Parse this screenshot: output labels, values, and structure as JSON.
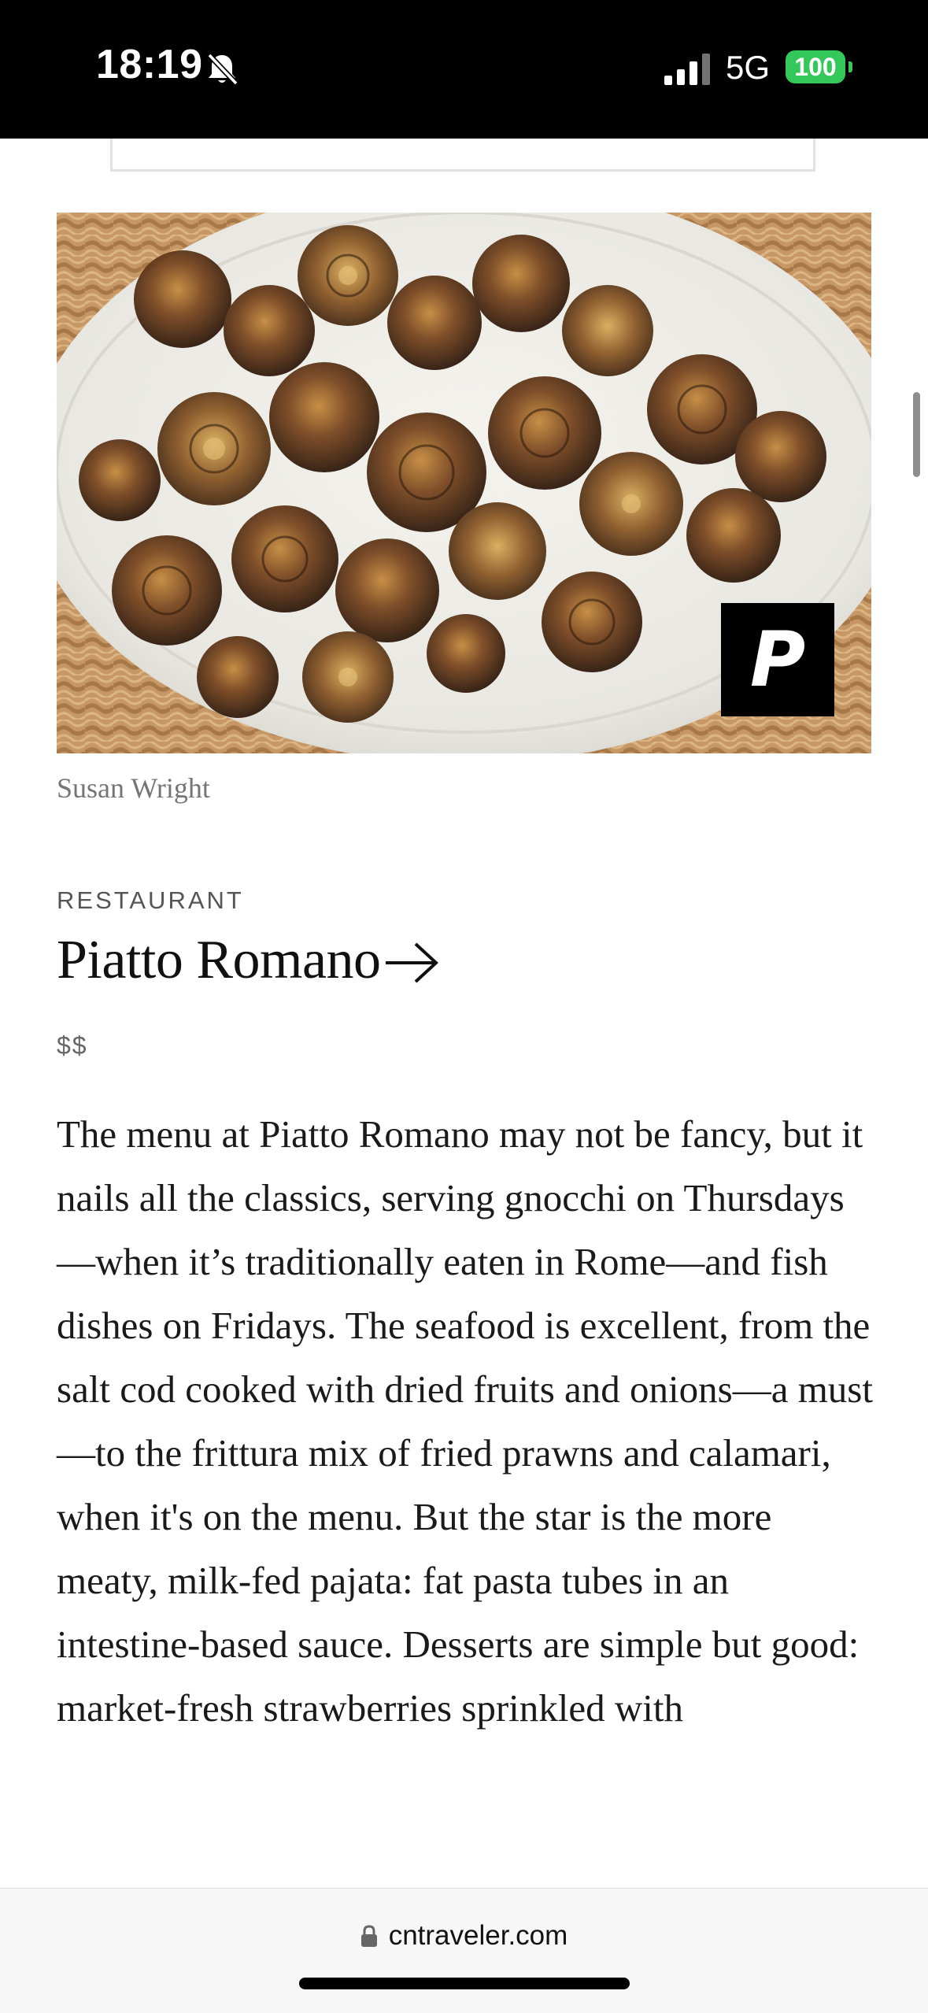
{
  "status_bar": {
    "time": "18:19",
    "network": "5G",
    "battery": "100",
    "icons": [
      "bell-slash-icon",
      "signal-icon",
      "battery-icon"
    ]
  },
  "photo": {
    "alt": "Fried artichokes on a white oval platter",
    "credit": "Susan Wright",
    "pin_icon": "pinterest-icon",
    "pin_letter": "P"
  },
  "listing": {
    "category": "RESTAURANT",
    "title": "Piatto Romano",
    "title_icon": "arrow-right-icon",
    "price": "$$",
    "description": "The menu at Piatto Romano may not be fancy, but it nails all the classics, serving gnocchi on Thursdays—when it’s traditionally eaten in Rome—and fish dishes on Fridays. The seafood is excellent, from the salt cod cooked with dried fruits and onions—a must—to the frittura mix of fried prawns and calamari, when it's on the menu. But the star is the more meaty, milk-fed pajata: fat pasta tubes in an intestine-based sauce. Desserts are simple but good: market-fresh strawberries sprinkled with"
  },
  "browser": {
    "url": "cntraveler.com",
    "lock_icon": "lock-icon"
  },
  "colors": {
    "status_bg": "#000000",
    "battery_green": "#34c759",
    "text_primary": "#111111",
    "text_muted": "#757575"
  }
}
